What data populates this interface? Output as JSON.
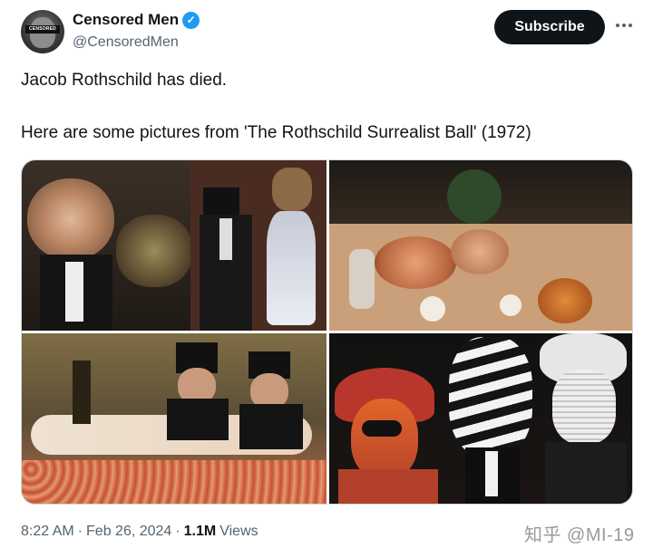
{
  "author": {
    "avatar_text": "CENSORED",
    "name": "Censored Men",
    "verified_icon": "verified-check-icon",
    "handle": "@CensoredMen"
  },
  "actions": {
    "subscribe_label": "Subscribe",
    "more_icon": "more-options-icon"
  },
  "tweet": {
    "line1": "Jacob Rothschild has died.",
    "line2": "Here are some pictures from 'The Rothschild Surrealist Ball' (1972)"
  },
  "meta": {
    "time": "8:22 AM",
    "sep1": "·",
    "date": "Feb 26, 2024",
    "sep2": "·",
    "views_count": "1.1M",
    "views_label": "Views"
  },
  "watermark": "知乎 @MI-19",
  "colors": {
    "accent": "#1d9bf0",
    "button_bg": "#0f1419",
    "secondary_text": "#536471"
  }
}
